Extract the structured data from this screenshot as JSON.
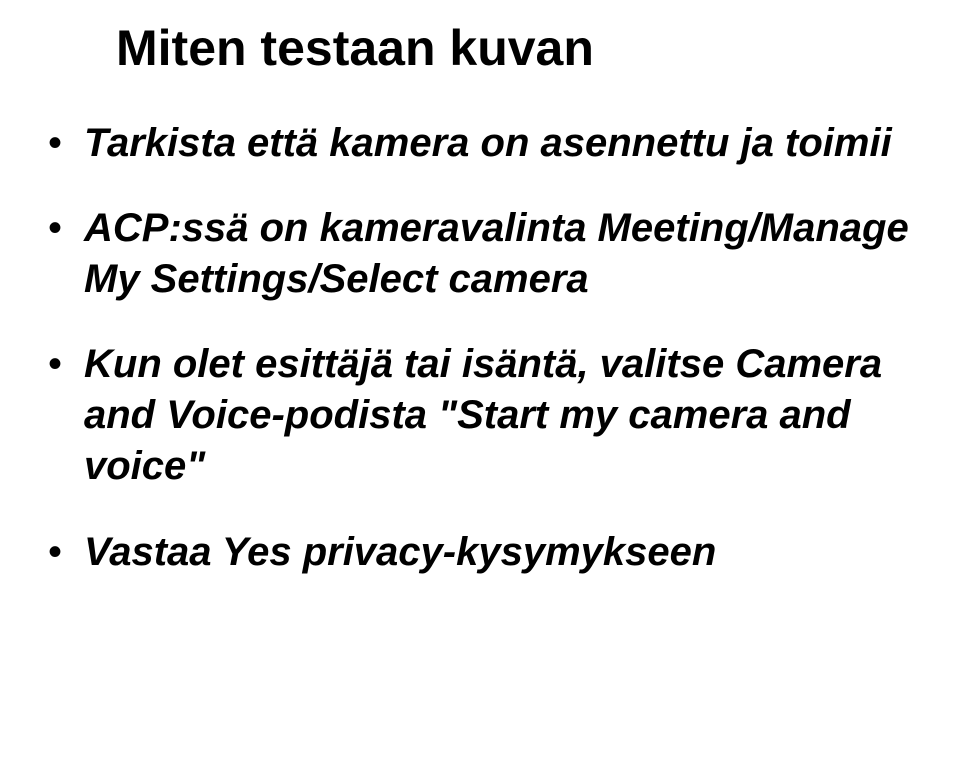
{
  "title": "Miten testaan kuvan",
  "bullets": [
    "Tarkista että kamera on asennettu ja toimii",
    "ACP:ssä on kameravalinta Meeting/Manage My Settings/Select camera",
    "Kun olet esittäjä tai isäntä, valitse Camera and Voice-podista \"Start my camera and voice\"",
    "Vastaa Yes privacy-kysymykseen"
  ]
}
